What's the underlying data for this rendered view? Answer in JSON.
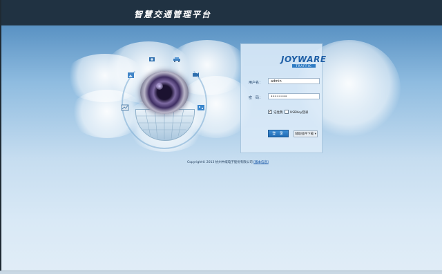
{
  "header": {
    "title": "智慧交通管理平台"
  },
  "brand": {
    "name": "JOYWARE",
    "sub": "TRAFFIC",
    "color": "#1f5fa6"
  },
  "login": {
    "username_label": "用户名：",
    "username_value": "admin",
    "password_label": "密　码：",
    "password_value": "••••••••",
    "remember_label": "记住我",
    "remember_checked": true,
    "usbkey_label": "USBKey登录",
    "usbkey_checked": false,
    "login_button": "登 录",
    "download_button": "辅助插件下载 ▾"
  },
  "footer": {
    "copyright": "Copyright© 2013 杭州中威电子股份有限公司",
    "link": "[版本信息]"
  },
  "icons": [
    "camera-icon",
    "car-icon",
    "video-icon",
    "map-icon",
    "picture-icon",
    "chart-icon"
  ],
  "colors": {
    "header_bg": "#203242",
    "accent": "#1f6bb3"
  }
}
